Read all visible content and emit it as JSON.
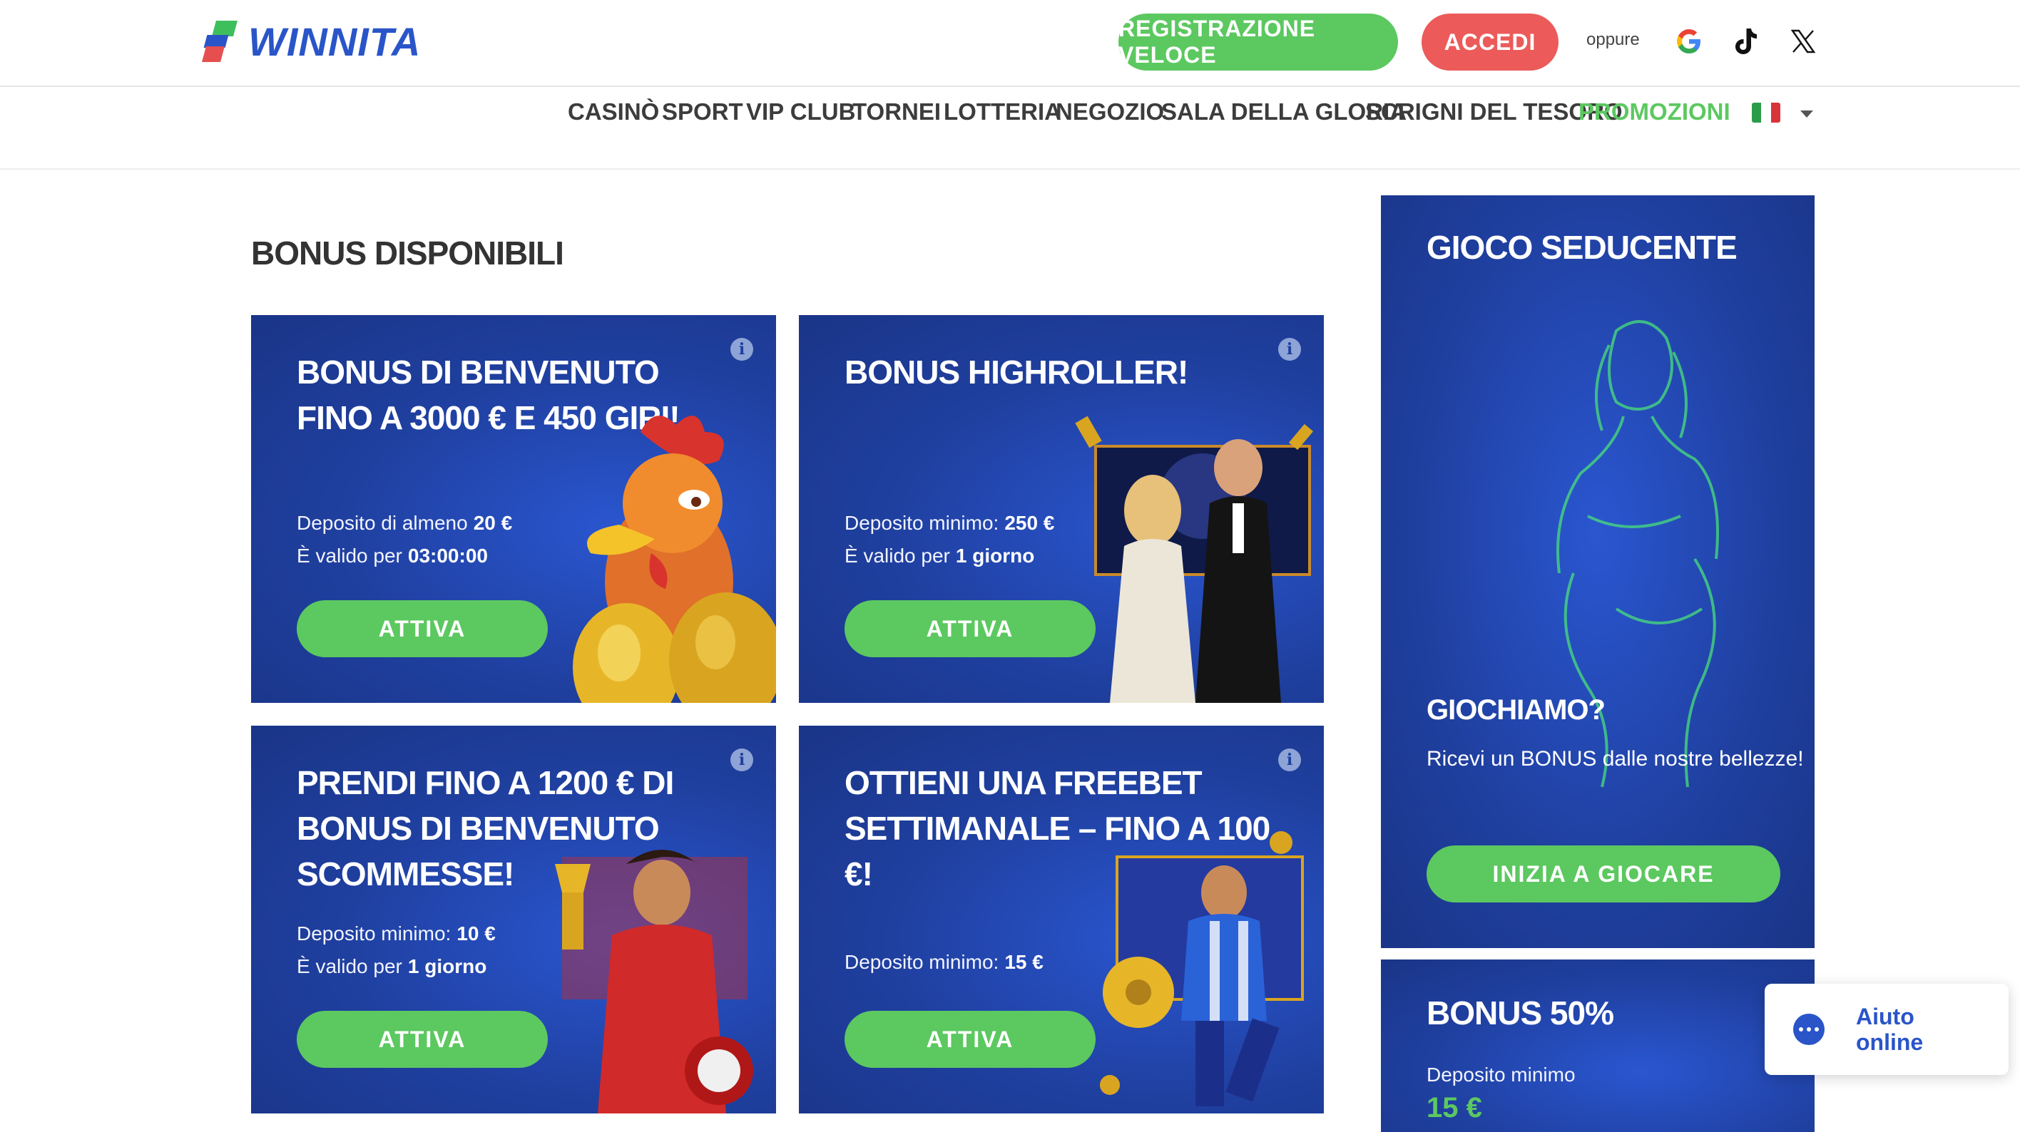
{
  "brand": {
    "name": "WINNITA",
    "colors": {
      "blue": "#2a55c9",
      "green": "#5cc860",
      "red": "#ec5a5a",
      "card_bg": "#1f3f9e"
    }
  },
  "header": {
    "register_label": "REGISTRAZIONE VELOCE",
    "login_label": "ACCEDI",
    "or_label": "oppure",
    "social": [
      "google-icon",
      "tiktok-icon",
      "x-icon"
    ]
  },
  "nav": {
    "items": [
      {
        "label": "CASINÒ"
      },
      {
        "label": "SPORT"
      },
      {
        "label": "VIP CLUB"
      },
      {
        "label": "TORNEI"
      },
      {
        "label": "LOTTERIA"
      },
      {
        "label": "NEGOZIO"
      },
      {
        "label": "SALA DELLA GLORIA"
      },
      {
        "label": "SCRIGNI DEL TESORO"
      },
      {
        "label": "PROMOZIONI",
        "active": true
      }
    ],
    "language_flag": "italy-flag-icon"
  },
  "main": {
    "section_title": "BONUS DISPONIBILI",
    "cards": [
      {
        "title": "BONUS DI BENVENUTO FINO A 3000 € E 450 GIRI!",
        "line1_label": "Deposito di almeno",
        "line1_value": "20 €",
        "line2_label": "È valido per",
        "line2_value": "03:00:00",
        "button": "ATTIVA"
      },
      {
        "title": "BONUS HIGHROLLER!",
        "line1_label": "Deposito minimo:",
        "line1_value": "250 €",
        "line2_label": "È valido per",
        "line2_value": "1 giorno",
        "button": "ATTIVA"
      },
      {
        "title": "PRENDI FINO A 1200 € DI BONUS DI BENVENUTO SCOMMESSE!",
        "line1_label": "Deposito minimo:",
        "line1_value": "10 €",
        "line2_label": "È valido per",
        "line2_value": "1 giorno",
        "button": "ATTIVA"
      },
      {
        "title": "OTTIENI UNA FREEBET SETTIMANALE – FINO A 100 €!",
        "line1_label": "Deposito minimo:",
        "line1_value": "15 €",
        "button": "ATTIVA"
      }
    ]
  },
  "sidebar": {
    "promo": {
      "title": "GIOCO SEDUCENTE",
      "subtitle": "GIOCHIAMO?",
      "description": "Ricevi un BONUS dalle nostre bellezze!",
      "button": "INIZIA A GIOCARE"
    },
    "promo2": {
      "title": "BONUS 50%",
      "label": "Deposito minimo",
      "amount": "15 €"
    }
  },
  "chat": {
    "line1": "Aiuto",
    "line2": "online"
  }
}
